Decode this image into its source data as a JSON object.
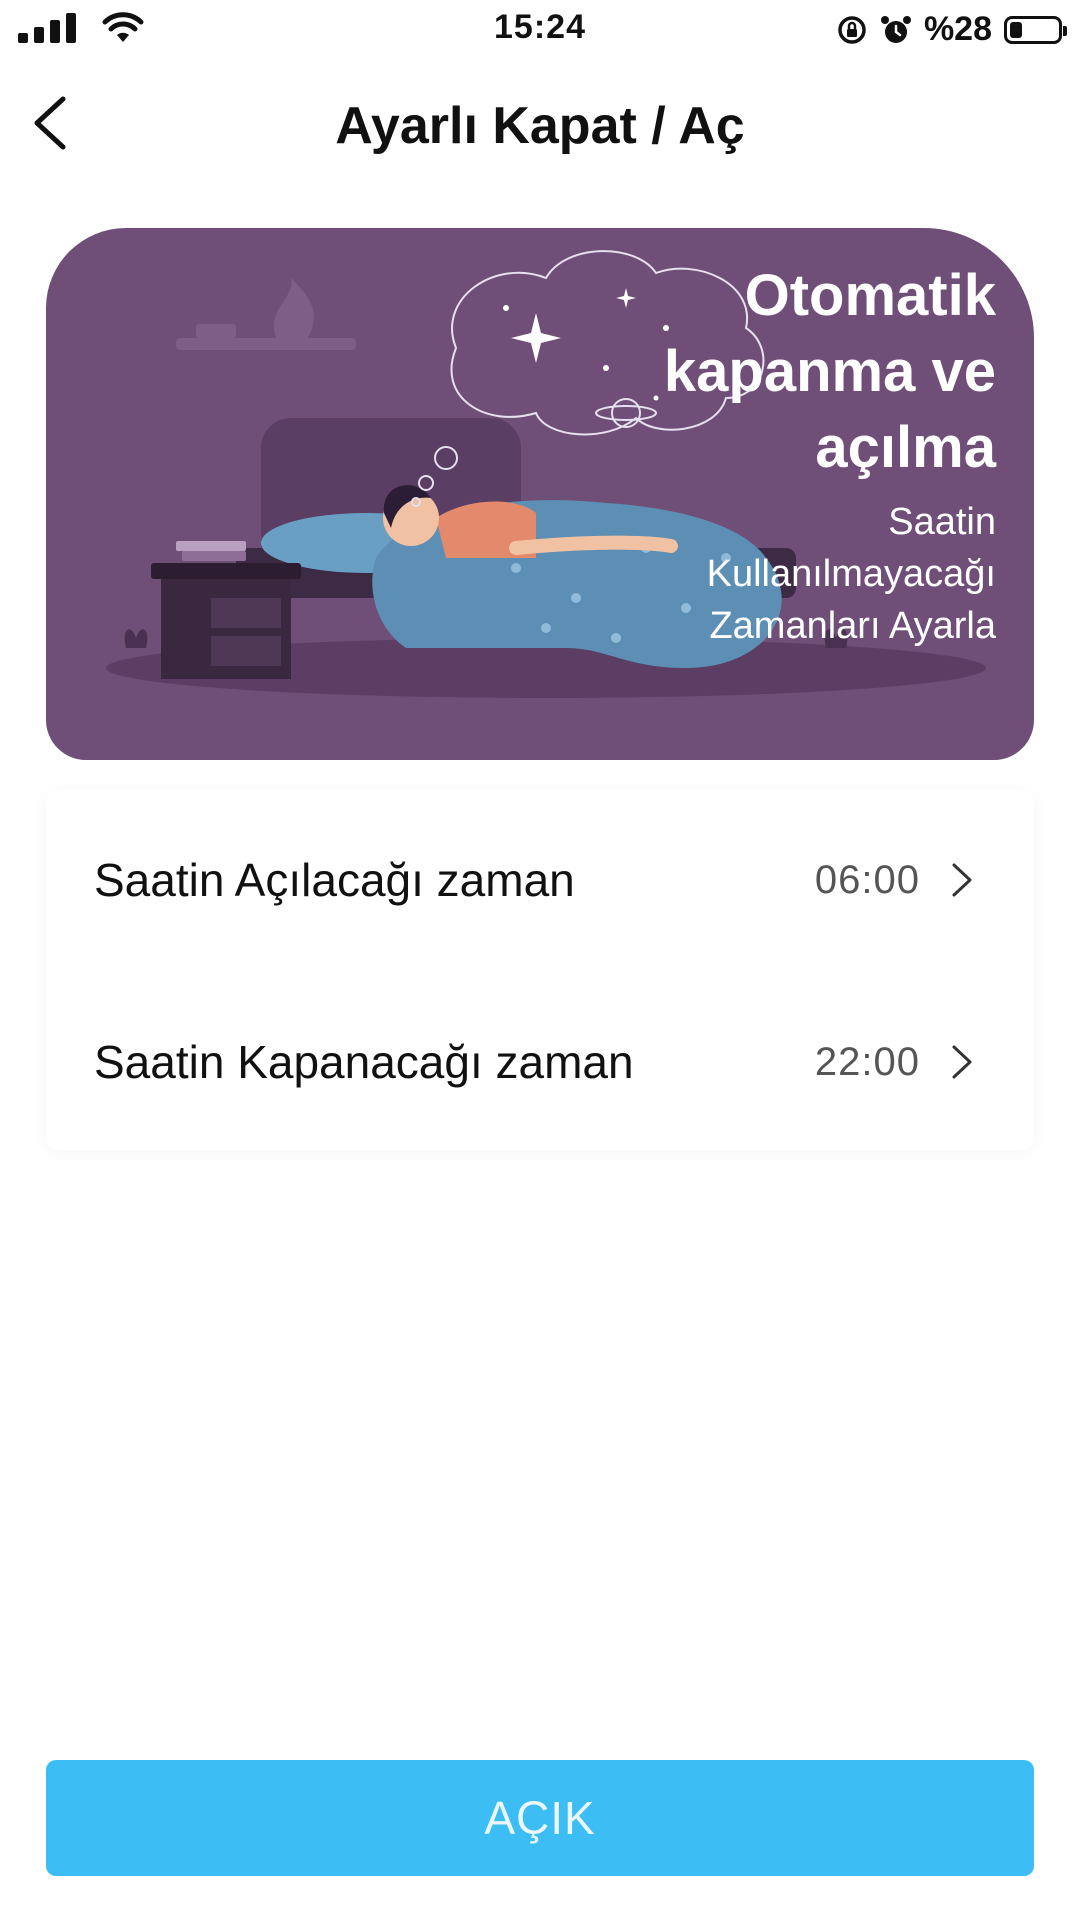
{
  "status_bar": {
    "time": "15:24",
    "battery": "%28",
    "icons": [
      "signal-icon",
      "wifi-icon",
      "rotation-lock-icon",
      "alarm-icon",
      "battery-icon"
    ]
  },
  "header": {
    "title": "Ayarlı Kapat / Aç",
    "back_icon": "chevron-left-icon"
  },
  "banner": {
    "title": "Otomatik kapanma ve açılma",
    "subtitle": "Saatin Kullanılmayacağı Zamanları Ayarla",
    "background_color": "#6f4f78"
  },
  "settings": [
    {
      "label": "Saatin Açılacağı zaman",
      "value": "06:00"
    },
    {
      "label": "Saatin Kapanacağı zaman",
      "value": "22:00"
    }
  ],
  "action_button": {
    "label": "AÇIK",
    "color": "#3cbef4"
  }
}
